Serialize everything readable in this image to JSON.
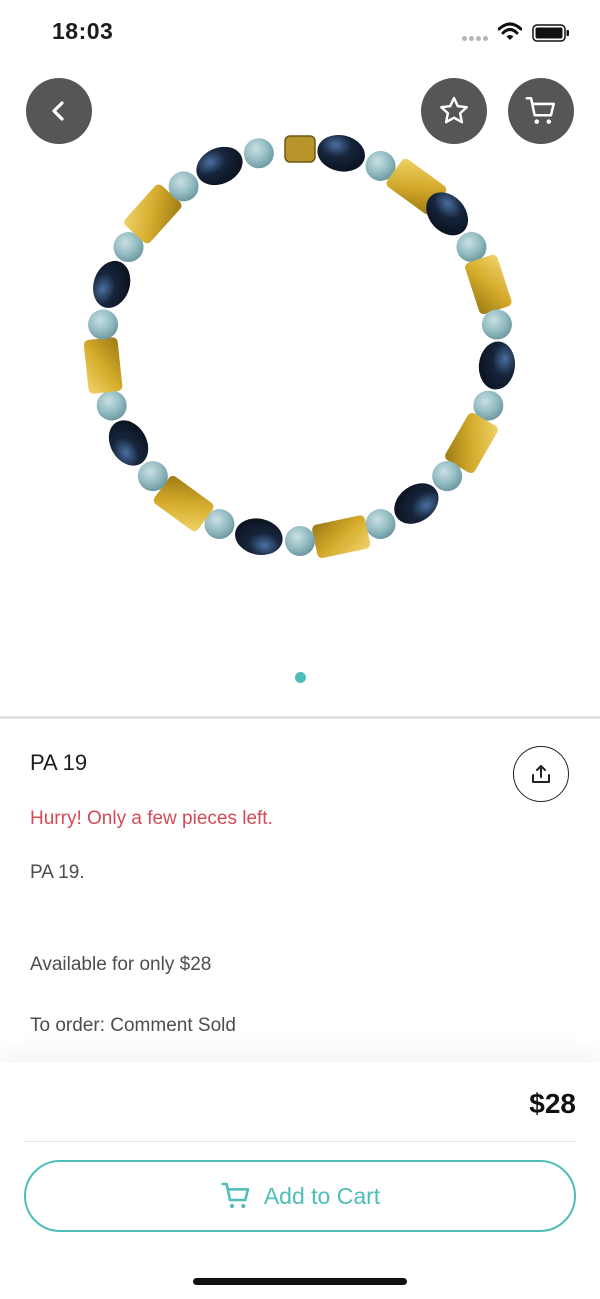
{
  "status_bar": {
    "time": "18:03",
    "icons": [
      "signal-dots-icon",
      "wifi-icon",
      "battery-icon"
    ]
  },
  "header": {
    "back_icon": "chevron-left-icon",
    "favorite_icon": "star-icon",
    "cart_icon": "cart-icon"
  },
  "gallery": {
    "image": "beaded-bracelet-photo",
    "page_count": 1,
    "active_page": 1
  },
  "product": {
    "title": "PA 19",
    "stock_warning": "Hurry! Only a few pieces left.",
    "description": "PA 19.",
    "availability": "Available for only $28",
    "order_info": "To order: Comment Sold",
    "share_icon": "share-icon"
  },
  "purchase": {
    "price": "$28",
    "add_to_cart_label": "Add to Cart",
    "add_to_cart_icon": "cart-icon"
  },
  "colors": {
    "accent": "#4fbdba",
    "warning": "#d44a56",
    "button_dark": "#565656"
  }
}
